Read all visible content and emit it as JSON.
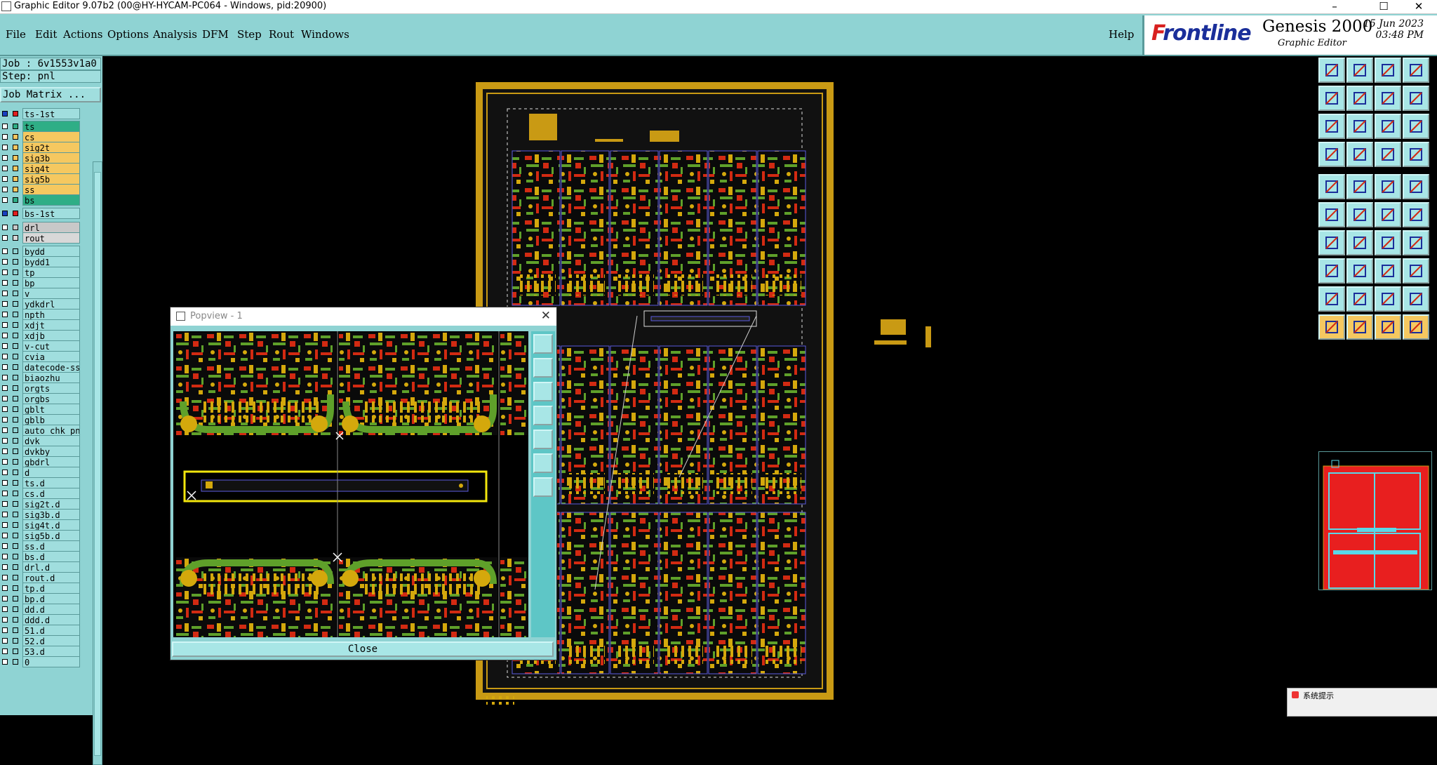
{
  "window": {
    "title": "Graphic Editor 9.07b2 (00@HY-HYCAM-PC064 - Windows, pid:20900)",
    "minimize": "–",
    "maximize": "☐",
    "close": "✕"
  },
  "menu": {
    "items": [
      "File",
      "Edit",
      "Actions",
      "Options",
      "Analysis",
      "DFM",
      "Step",
      "Rout",
      "Windows"
    ],
    "help": "Help"
  },
  "brand": {
    "logo_first": "F",
    "logo_rest": "rontline",
    "product": "Genesis 2000",
    "subtitle": "Graphic Editor",
    "date": "15 Jun 2023",
    "time": "03:48 PM"
  },
  "job": {
    "job_label": "Job : 6v1553v1a0",
    "step_label": "Step: pnl",
    "job_matrix": "Job Matrix ..."
  },
  "layer_groups": {
    "top_group": "ts-1st",
    "bottom_group": "bs-1st"
  },
  "layers": [
    {
      "name": "ts",
      "color": "#2fae86"
    },
    {
      "name": "cs",
      "color": "#f5c860"
    },
    {
      "name": "sig2t",
      "color": "#f5c860"
    },
    {
      "name": "sig3b",
      "color": "#f5c860"
    },
    {
      "name": "sig4t",
      "color": "#f5c860"
    },
    {
      "name": "sig5b",
      "color": "#f5c860"
    },
    {
      "name": "ss",
      "color": "#f5c860"
    },
    {
      "name": "bs",
      "color": "#2fae86"
    }
  ],
  "drill_layers": [
    {
      "name": "drl",
      "color": "#c8c8c8"
    },
    {
      "name": "rout",
      "color": "#d8d8d8"
    }
  ],
  "misc_layers": [
    "bydd",
    "bydd1",
    "tp",
    "bp",
    "v",
    "ydkdrl",
    "npth",
    "xdjt",
    "xdjb",
    "v-cut",
    "cvia",
    "datecode-ss",
    "biaozhu",
    "orgts",
    "orgbs",
    "gblt",
    "gblb",
    "auto_chk_pn",
    "dvk",
    "dvkby",
    "gbdrl",
    "d",
    "ts.d",
    "cs.d",
    "sig2t.d",
    "sig3b.d",
    "sig4t.d",
    "sig5b.d",
    "ss.d",
    "bs.d",
    "drl.d",
    "rout.d",
    "tp.d",
    "bp.d",
    "dd.d",
    "ddd.d",
    "51.d",
    "52.d",
    "53.d",
    "0"
  ],
  "popview": {
    "title": "Popview - 1",
    "close_label": "Close"
  },
  "system_note": {
    "label": "系统提示"
  },
  "colors": {
    "ui_bg": "#8fd3d3",
    "copper": "#d22a12",
    "mask": "#5fa02a",
    "pad": "#d4a80c",
    "board_frame": "#c99a14",
    "outline": "#5b5be0"
  }
}
